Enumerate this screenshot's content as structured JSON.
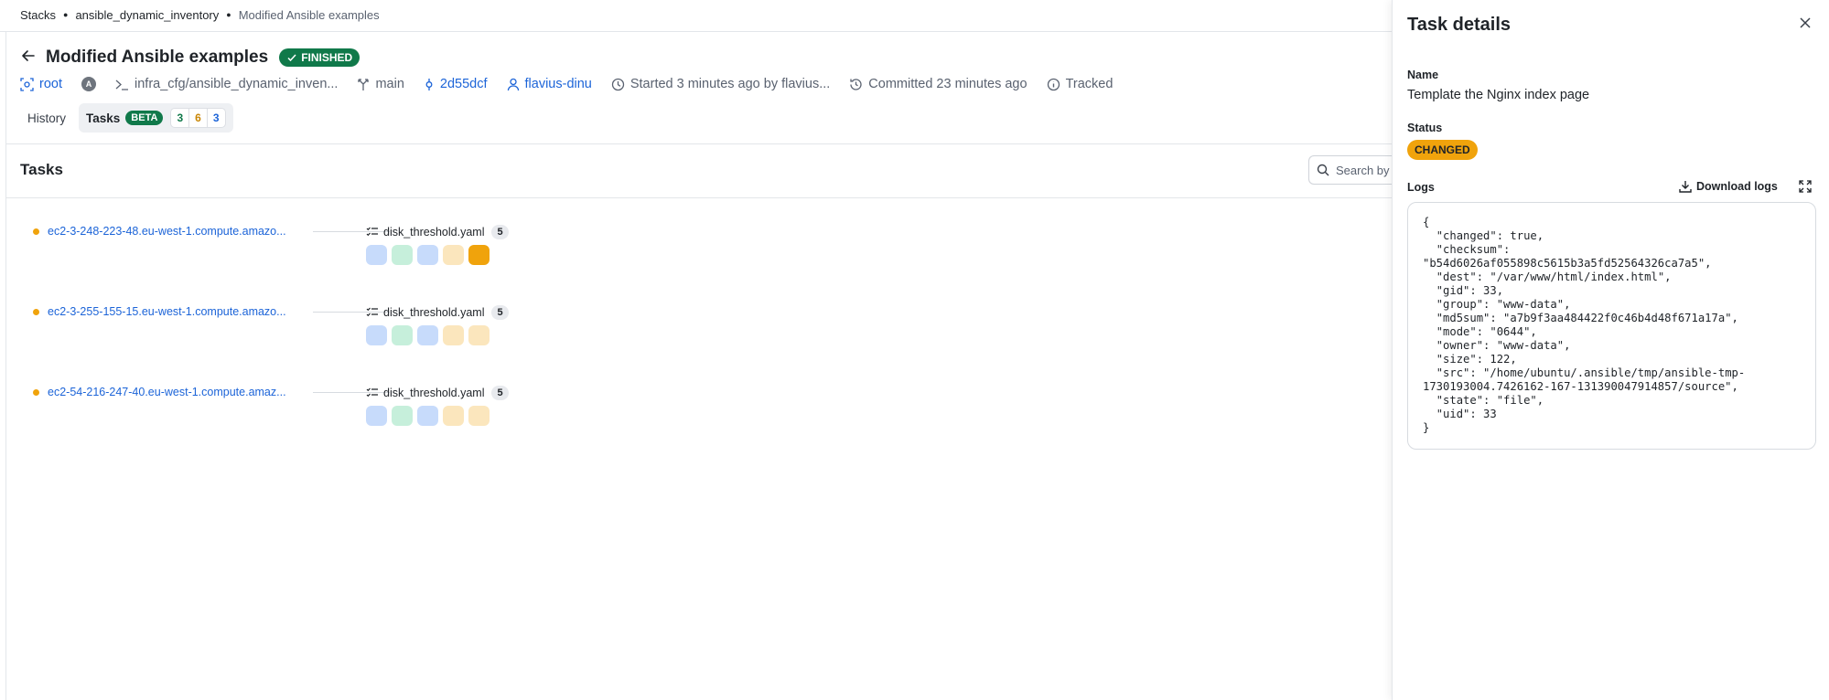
{
  "breadcrumb": {
    "items": [
      "Stacks",
      "ansible_dynamic_inventory"
    ],
    "current": "Modified Ansible examples"
  },
  "header": {
    "title": "Modified Ansible examples",
    "status": "FINISHED"
  },
  "meta": {
    "space": "root",
    "avatar_letter": "A",
    "path": "infra_cfg/ansible_dynamic_inven...",
    "branch": "main",
    "commit": "2d55dcf",
    "user": "flavius-dinu",
    "started": "Started 3 minutes ago by flavius...",
    "committed": "Committed 23 minutes ago",
    "tracked": "Tracked"
  },
  "tabs": {
    "history": "History",
    "tasks": "Tasks",
    "beta": "BETA",
    "counts": [
      "3",
      "6",
      "3"
    ]
  },
  "section": {
    "title": "Tasks",
    "search_placeholder": "Search by"
  },
  "tasks": [
    {
      "host": "ec2-3-248-223-48.eu-west-1.compute.amazo...",
      "playbook": "disk_threshold.yaml",
      "count": "5",
      "steps": [
        "#c7dbfb",
        "#c6efdb",
        "#c7dbfb",
        "#fbe6bd",
        "#f0a30c"
      ]
    },
    {
      "host": "ec2-3-255-155-15.eu-west-1.compute.amazo...",
      "playbook": "disk_threshold.yaml",
      "count": "5",
      "steps": [
        "#c7dbfb",
        "#c6efdb",
        "#c7dbfb",
        "#fbe6bd",
        "#fbe6bd"
      ]
    },
    {
      "host": "ec2-54-216-247-40.eu-west-1.compute.amaz...",
      "playbook": "disk_threshold.yaml",
      "count": "5",
      "steps": [
        "#c7dbfb",
        "#c6efdb",
        "#c7dbfb",
        "#fbe6bd",
        "#fbe6bd"
      ]
    }
  ],
  "panel": {
    "title": "Task details",
    "name_label": "Name",
    "name_value": "Template the Nginx index page",
    "status_label": "Status",
    "status_value": "CHANGED",
    "logs_label": "Logs",
    "download_label": "Download logs",
    "log_text": "{\n  \"changed\": true,\n  \"checksum\":\n\"b54d6026af055898c5615b3a5fd52564326ca7a5\",\n  \"dest\": \"/var/www/html/index.html\",\n  \"gid\": 33,\n  \"group\": \"www-data\",\n  \"md5sum\": \"a7b9f3aa484422f0c46b4d48f671a17a\",\n  \"mode\": \"0644\",\n  \"owner\": \"www-data\",\n  \"size\": 122,\n  \"src\": \"/home/ubuntu/.ansible/tmp/ansible-tmp-\n1730193004.7426162-167-131390047914857/source\",\n  \"state\": \"file\",\n  \"uid\": 33\n}"
  }
}
